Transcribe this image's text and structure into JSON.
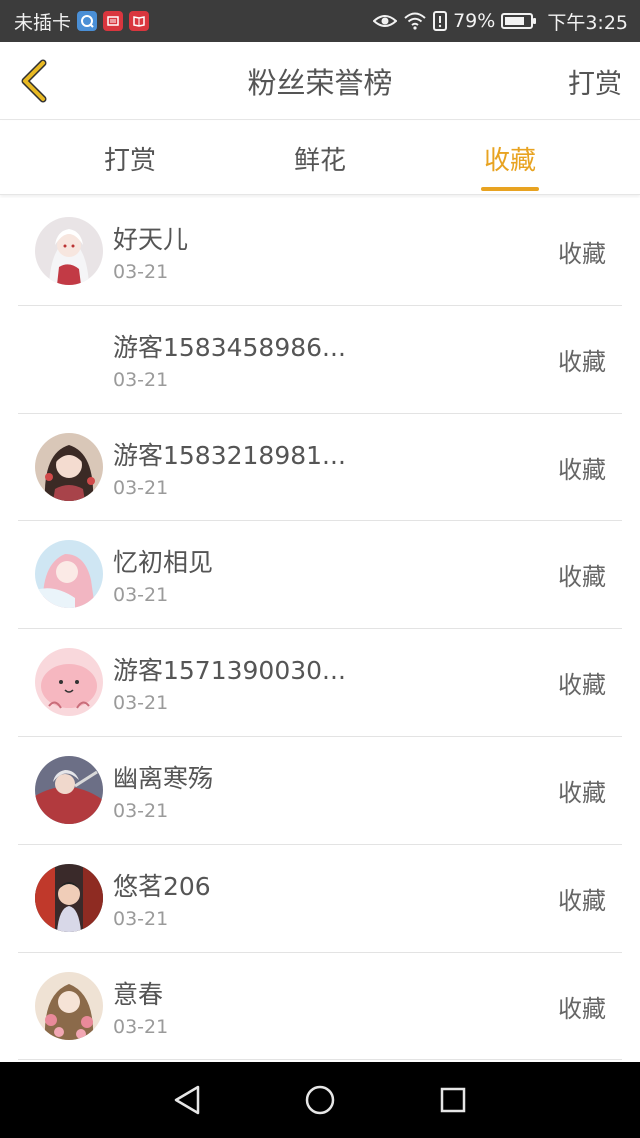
{
  "status_bar": {
    "carrier": "未插卡",
    "battery_percent": "79%",
    "battery_level": 0.79,
    "time": "下午3:25",
    "app_icons": [
      "browser-app-icon",
      "news-app-icon",
      "reader-app-icon"
    ],
    "status_icons": [
      "eye-comfort-icon",
      "wifi-icon",
      "alert-icon",
      "battery-icon"
    ]
  },
  "header": {
    "back_icon": "chevron-left-icon",
    "title": "粉丝荣誉榜",
    "action_label": "打赏"
  },
  "tabs": [
    {
      "label": "打赏",
      "active": false
    },
    {
      "label": "鲜花",
      "active": false
    },
    {
      "label": "收藏",
      "active": true
    }
  ],
  "colors": {
    "accent": "#e8a321",
    "text_primary": "#555555",
    "text_secondary": "#9a9a9a",
    "status_bar_bg": "#3c3c3c",
    "nav_bar_bg": "#000000"
  },
  "list": [
    {
      "name": "好天儿",
      "date": "03-21",
      "action": "收藏",
      "avatar": "anime-girl-white-hair"
    },
    {
      "name": "游客1583458986...",
      "date": "03-21",
      "action": "收藏",
      "avatar": "none"
    },
    {
      "name": "游客1583218981...",
      "date": "03-21",
      "action": "收藏",
      "avatar": "anime-girl-dark-hair"
    },
    {
      "name": "忆初相见",
      "date": "03-21",
      "action": "收藏",
      "avatar": "anime-girl-pink-hair"
    },
    {
      "name": "游客1571390030...",
      "date": "03-21",
      "action": "收藏",
      "avatar": "pink-blob-character"
    },
    {
      "name": "幽离寒殇",
      "date": "03-21",
      "action": "收藏",
      "avatar": "anime-warrior-red"
    },
    {
      "name": "悠茗206",
      "date": "03-21",
      "action": "收藏",
      "avatar": "photo-child"
    },
    {
      "name": "意春",
      "date": "03-21",
      "action": "收藏",
      "avatar": "anime-girl-flowers"
    }
  ],
  "android_nav": {
    "back": "back-triangle-icon",
    "home": "home-circle-icon",
    "recents": "recents-square-icon"
  }
}
